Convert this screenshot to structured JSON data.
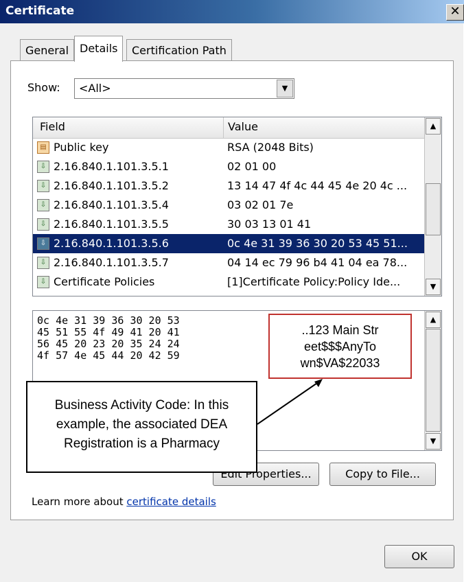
{
  "window": {
    "title": "Certificate",
    "close_glyph": "✕"
  },
  "tabs": [
    {
      "label": "General"
    },
    {
      "label": "Details",
      "active": true
    },
    {
      "label": "Certification Path"
    }
  ],
  "show": {
    "label": "Show:",
    "value": "<All>"
  },
  "field_list": {
    "header_field": "Field",
    "header_value": "Value",
    "rows": [
      {
        "field": "Public key",
        "value": "RSA (2048 Bits)",
        "icon": "public-key-icon"
      },
      {
        "field": "2.16.840.1.101.3.5.1",
        "value": "02 01 00",
        "icon": "extension-icon"
      },
      {
        "field": "2.16.840.1.101.3.5.2",
        "value": "13 14 47 4f 4c 44 45 4e 20 4c ...",
        "icon": "extension-icon"
      },
      {
        "field": "2.16.840.1.101.3.5.4",
        "value": "03 02 01 7e",
        "icon": "extension-icon"
      },
      {
        "field": "2.16.840.1.101.3.5.5",
        "value": "30 03 13 01 41",
        "icon": "extension-icon"
      },
      {
        "field": "2.16.840.1.101.3.5.6",
        "value": "0c 4e 31 39 36 30 20 53 45 51...",
        "icon": "extension-icon",
        "selected": true
      },
      {
        "field": "2.16.840.1.101.3.5.7",
        "value": "04 14 ec 79 96 b4 41 04 ea 78...",
        "icon": "extension-icon"
      },
      {
        "field": "Certificate Policies",
        "value": "[1]Certificate Policy:Policy Ide...",
        "icon": "extension-icon"
      }
    ]
  },
  "hex": {
    "lines": [
      "0c 4e 31 39 36 30 20 53",
      "45 51 55 4f 49 41 20 41",
      "56 45 20 23 20 35 24 24",
      "4f 57 4e 45 44 20 42 59"
    ]
  },
  "callouts": {
    "address_lines": [
      "..123 Main Str",
      "eet$$$AnyTo",
      "wn$VA$22033"
    ],
    "business_lines": [
      "Business Activity Code: In this",
      "example, the associated DEA",
      "Registration is a Pharmacy"
    ]
  },
  "buttons": {
    "edit_properties": "Edit Properties...",
    "copy_to_file": "Copy to File...",
    "ok": "OK"
  },
  "learn_more": {
    "text": "Learn more about ",
    "link": "certificate details"
  },
  "colors": {
    "selection": "#0a246a",
    "callout_border": "#c0322e",
    "link": "#0033aa"
  }
}
